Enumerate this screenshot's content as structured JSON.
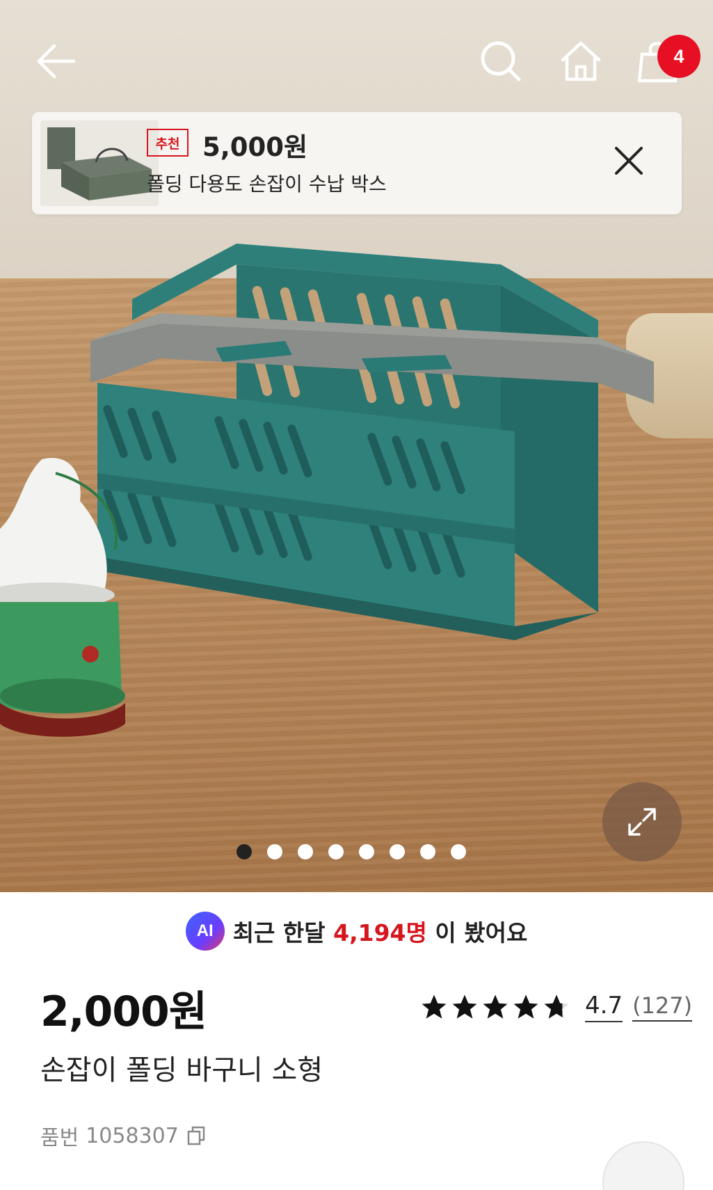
{
  "nav": {
    "back_icon": "arrow-left-icon",
    "search_icon": "search-icon",
    "home_icon": "home-icon",
    "cart_icon": "shopping-bag-icon",
    "cart_count": "4"
  },
  "recommendation": {
    "tag": "추천",
    "price": "5,000원",
    "name": "폴딩 다용도 손잡이 수납 박스",
    "close_icon": "close-icon"
  },
  "gallery": {
    "total_images": 8,
    "active_index": 0,
    "expand_icon": "expand-icon"
  },
  "views": {
    "badge": "AI",
    "prefix": "최근 한달",
    "count": "4,194명",
    "suffix": "이 봤어요"
  },
  "product": {
    "price": "2,000원",
    "name": "손잡이 폴딩 바구니 소형",
    "rating": 4.7,
    "rating_text": "4.7",
    "review_count": "(127)",
    "sku_label": "품번",
    "sku": "1058307"
  },
  "colors": {
    "accent": "#e60f23",
    "text": "#222222"
  }
}
